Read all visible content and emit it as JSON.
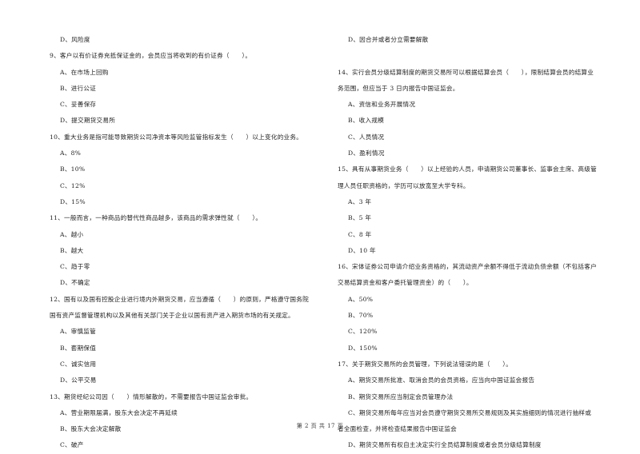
{
  "left_column": {
    "q8_tail": {
      "options": [
        "D、风险度"
      ]
    },
    "q9": {
      "stem": "9、客户以有价证券充抵保证金的，会员应当将收到的有价证券（　　）。",
      "options": [
        "A、在市场上回购",
        "B、进行公证",
        "C、妥善保存",
        "D、提交期货交易所"
      ]
    },
    "q10": {
      "stem": "10、重大业务是指可能导致期货公司净资本等风险监管指标发生（　　）以上变化的业务。",
      "options": [
        "A、8%",
        "B、10%",
        "C、12%",
        "D、15%"
      ]
    },
    "q11": {
      "stem": "11、一般而言，一种商品的替代性商品越多，该商品的需求弹性就（　　）。",
      "options": [
        "A、越小",
        "B、越大",
        "C、趋于零",
        "D、不确定"
      ]
    },
    "q12": {
      "stem_line1": "12、国有以及国有控股企业进行境内外期货交易，应当遵循（　　）的原则，严格遵守国务院",
      "stem_line2": "国有资产监督管理机构以及其他有关部门关于企业以国有资产进入期货市场的有关规定。",
      "options": [
        "A、审慎监管",
        "B、套期保值",
        "C、诚实信用",
        "D、公平交易"
      ]
    },
    "q13": {
      "stem": "13、期货经纪公司因（　　）情形解散的，不需要报告中国证监会审批。",
      "options": [
        "A、营业期限届满，股东大会决定不再延续",
        "B、股东大会决定解散",
        "C、破产"
      ]
    }
  },
  "right_column": {
    "q13_tail": {
      "options": [
        "D、因合并或者分立需要解散"
      ]
    },
    "q14": {
      "stem_line1": "14、实行会员分级结算制度的期货交易所可以根据结算会员（　　），限制结算会员的结算业",
      "stem_line2": "务范围，但应当于 3 日内报告中国证监会。",
      "options": [
        "A、资信和业务开展情况",
        "B、收入规模",
        "C、人员情况",
        "D、盈利情况"
      ]
    },
    "q15": {
      "stem_line1": "15、具有从事期货业务（　　）以上经验的人员，申请期货公司董事长、监事会主席、高级管",
      "stem_line2": "理人员任职资格的，学历可以放宽至大学专科。",
      "options": [
        "A、3 年",
        "B、5 年",
        "C、8 年",
        "D、10 年"
      ]
    },
    "q16": {
      "stem_line1": "16、宋体证券公司申请介绍业务资格的，其流动资产余额不得低于流动负债余额（不包括客户",
      "stem_line2": "交易结算资金和客户委托管理资金）的（　　）。",
      "options": [
        "A、50%",
        "B、70%",
        "C、120%",
        "D、150%"
      ]
    },
    "q17": {
      "stem": "17、关于期货交易所的会员管理，下列说法错误的是（　　）。",
      "option_a": "A、期货交易所批准、取消会员的会员资格，应当向中国证监会报告",
      "option_b": "B、期货交易所应当制定会员管理办法",
      "option_c_line1": "C、期货交易所每年应当对会员遵守期货交易所交易规则及其实施细则的情况进行抽样或",
      "option_c_line2": "者全面检查，并将检查结果报告中国证监会",
      "option_d": "D、期货交易所有权自主决定实行全员结算制度或者会员分级结算制度"
    }
  },
  "footer": {
    "page_indicator": "第 2 页 共 17 页"
  }
}
